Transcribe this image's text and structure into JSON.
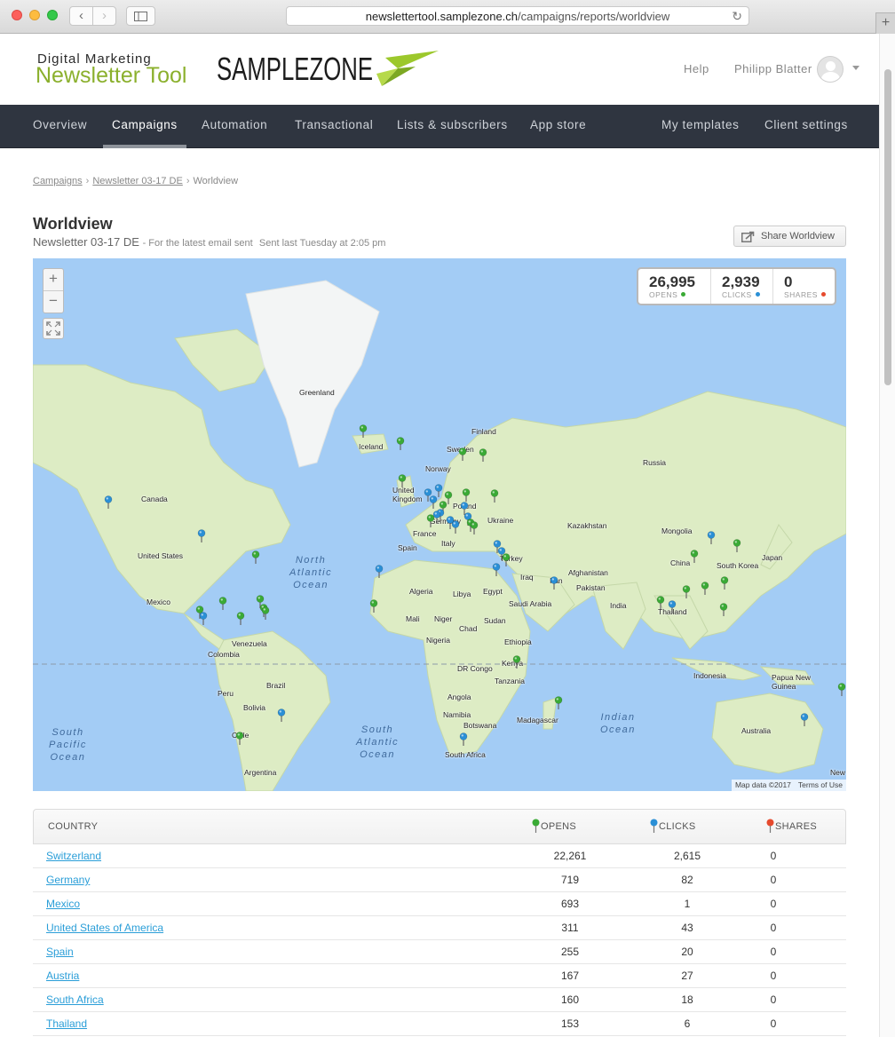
{
  "browser": {
    "url_domain": "newslettertool.samplezone.ch",
    "url_path": "/campaigns/reports/worldview"
  },
  "header": {
    "brand_line1": "Digital Marketing",
    "brand_line2": "Newsletter Tool",
    "logo_text": "SAMPLEZONE",
    "help": "Help",
    "user_name": "Philipp Blatter"
  },
  "nav": {
    "items": [
      "Overview",
      "Campaigns",
      "Automation",
      "Transactional",
      "Lists & subscribers",
      "App store",
      "My templates",
      "Client settings"
    ],
    "active": "Campaigns"
  },
  "breadcrumb": {
    "items": [
      "Campaigns",
      "Newsletter 03-17 DE",
      "Worldview"
    ]
  },
  "page": {
    "title": "Worldview",
    "campaign": "Newsletter 03-17 DE",
    "latest_note": "- For the latest email sent",
    "sent_note": "Sent last Tuesday at 2:05 pm",
    "share_button": "Share Worldview"
  },
  "map": {
    "zoom_in": "+",
    "zoom_out": "−",
    "stats": {
      "opens": {
        "value": "26,995",
        "label": "OPENS",
        "color": "#3aaa35"
      },
      "clicks": {
        "value": "2,939",
        "label": "CLICKS",
        "color": "#2a8fd6"
      },
      "shares": {
        "value": "0",
        "label": "SHARES",
        "color": "#e64a2e"
      }
    },
    "labels": {
      "greenland": "Greenland",
      "iceland": "Iceland",
      "finland": "Finland",
      "sweden": "Sweden",
      "norway": "Norway",
      "russia": "Russia",
      "united_kingdom": "United\nKingdom",
      "poland": "Poland",
      "germany": "Germany",
      "ukraine": "Ukraine",
      "france": "France",
      "italy": "Italy",
      "spain": "Spain",
      "kazakhstan": "Kazakhstan",
      "mongolia": "Mongolia",
      "canada": "Canada",
      "united_states": "United States",
      "turkey": "Turkey",
      "iraq": "Iraq",
      "iran": "Iran",
      "afghanistan": "Afghanistan",
      "pakistan": "Pakistan",
      "china": "China",
      "south_korea": "South Korea",
      "japan": "Japan",
      "india": "India",
      "mexico": "Mexico",
      "algeria": "Algeria",
      "libya": "Libya",
      "egypt": "Egypt",
      "saudi_arabia": "Saudi Arabia",
      "mali": "Mali",
      "niger": "Niger",
      "chad": "Chad",
      "sudan": "Sudan",
      "nigeria": "Nigeria",
      "ethiopia": "Ethiopia",
      "thailand": "Thailand",
      "venezuela": "Venezuela",
      "colombia": "Colombia",
      "dr_congo": "DR Congo",
      "kenya": "Kenya",
      "tanzania": "Tanzania",
      "indonesia": "Indonesia",
      "papua_new_guinea": "Papua New\nGuinea",
      "peru": "Peru",
      "brazil": "Brazil",
      "bolivia": "Bolivia",
      "angola": "Angola",
      "namibia": "Namibia",
      "botswana": "Botswana",
      "madagascar": "Madagascar",
      "south_africa": "South Africa",
      "chile": "Chile",
      "argentina": "Argentina",
      "australia": "Australia",
      "new": "New"
    },
    "oceans": {
      "north_atlantic": "North\nAtlantic\nOcean",
      "south_atlantic": "South\nAtlantic\nOcean",
      "south_pacific": "South\nPacific\nOcean",
      "indian": "Indian\nOcean"
    },
    "attribution": "Map data ©2017",
    "terms": "Terms of Use"
  },
  "table": {
    "headers": {
      "country": "COUNTRY",
      "opens": "OPENS",
      "clicks": "CLICKS",
      "shares": "SHARES"
    },
    "rows": [
      {
        "country": "Switzerland",
        "opens": "22,261",
        "clicks": "2,615",
        "shares": "0"
      },
      {
        "country": "Germany",
        "opens": "719",
        "clicks": "82",
        "shares": "0"
      },
      {
        "country": "Mexico",
        "opens": "693",
        "clicks": "1",
        "shares": "0"
      },
      {
        "country": "United States of America",
        "opens": "311",
        "clicks": "43",
        "shares": "0"
      },
      {
        "country": "Spain",
        "opens": "255",
        "clicks": "20",
        "shares": "0"
      },
      {
        "country": "Austria",
        "opens": "167",
        "clicks": "27",
        "shares": "0"
      },
      {
        "country": "South Africa",
        "opens": "160",
        "clicks": "18",
        "shares": "0"
      },
      {
        "country": "Thailand",
        "opens": "153",
        "clicks": "6",
        "shares": "0"
      }
    ]
  }
}
